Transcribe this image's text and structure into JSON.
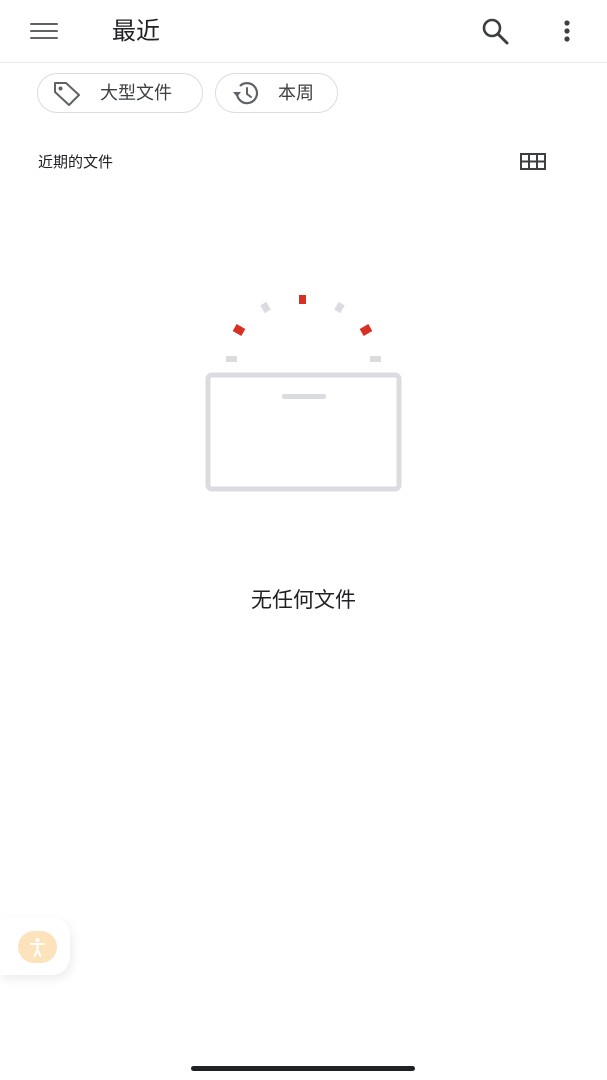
{
  "app_bar": {
    "title": "最近",
    "menu_icon": "hamburger-menu-icon",
    "search_icon": "search-icon",
    "more_icon": "more-vert-icon"
  },
  "filters": [
    {
      "label": "大型文件",
      "icon": "tag-icon"
    },
    {
      "label": "本周",
      "icon": "history-icon"
    }
  ],
  "section": {
    "title": "近期的文件",
    "view_toggle_icon": "grid-view-icon"
  },
  "empty_state": {
    "illustration": "empty-folder-illustration",
    "message": "无任何文件"
  },
  "accessibility": {
    "icon": "accessibility-icon",
    "color": "#fde3bb"
  },
  "colors": {
    "accent_red": "#d93025",
    "illustration_gray": "#dadce0"
  }
}
